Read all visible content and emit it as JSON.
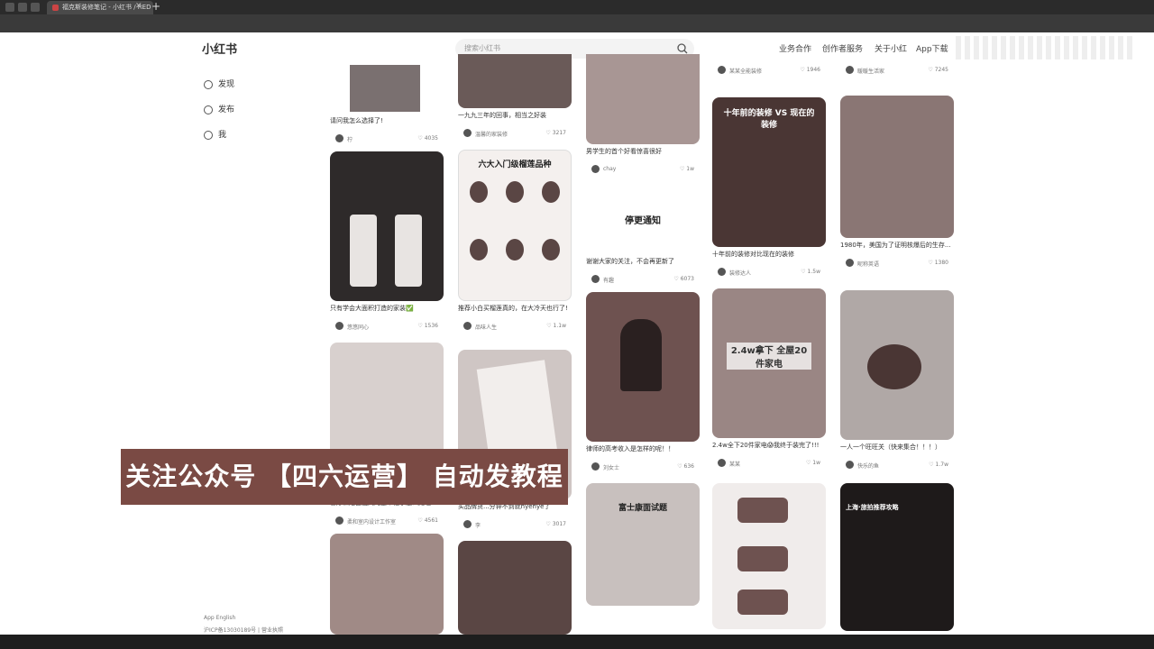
{
  "browser": {
    "tab_title": "福克斯装修笔记 - 小红书 / RED",
    "tab_close": "✕",
    "new_tab": "+"
  },
  "header": {
    "logo": "小红书",
    "search_placeholder": "搜索小红书",
    "nav": [
      "业务合作",
      "创作者服务",
      "关于小红",
      "App下载"
    ]
  },
  "sidebar": {
    "items": [
      {
        "label": "发现",
        "icon": "home-icon"
      },
      {
        "label": "发布",
        "icon": "plus-icon"
      },
      {
        "label": "我",
        "icon": "user-icon"
      }
    ],
    "footer_lang": "App   English",
    "footer_text": "沪ICP备13030189号 | 营业执照"
  },
  "feed": {
    "col1": [
      {
        "title": "请问我怎么选择了!",
        "author": "柠",
        "likes": "4035",
        "color": "#7a7070"
      },
      {
        "title": "只有学会大面积打造的家装✅",
        "author": "悠悠同心",
        "likes": "1536",
        "color": "#2e2a2a"
      },
      {
        "title": "客厅和阳台之间的这个柱子怎么处理",
        "author": "柔和室内设计工作室",
        "likes": "4561",
        "color": "#d8d0ce"
      },
      {
        "title": "",
        "author": "",
        "likes": "",
        "color": "#a08a86"
      }
    ],
    "col2": [
      {
        "title": "一九九三年的回事，相当之好装",
        "author": "温馨的家装修",
        "likes": "3217",
        "color": "#6a5a58"
      },
      {
        "title": "推荐小白买榴莲真的，在大冷天也行了!",
        "author": "品味人生",
        "likes": "1.1w",
        "color": "#f4f0ee",
        "overlay": "六大入门级榴莲品种"
      },
      {
        "title": "买品牌货...分钟不到就hyehye了",
        "author": "李",
        "likes": "3017",
        "color": "#cfc6c4"
      },
      {
        "title": "",
        "author": "",
        "likes": "",
        "color": "#5a4644"
      }
    ],
    "col3": [
      {
        "title": "男学生的首个好看惊喜很好",
        "author": "chay",
        "likes": "1w",
        "color": "#a89694"
      },
      {
        "title": "谢谢大家的关注，不会再更新了",
        "author": "有趣",
        "likes": "6073",
        "color": "#ffffff",
        "overlay": "停更通知"
      },
      {
        "title": "律师的高考收入是怎样的呢！！",
        "author": "刘女士",
        "likes": "636",
        "color": "#6e5250"
      },
      {
        "title": "",
        "author": "",
        "likes": "",
        "color": "#c8c0be",
        "overlay": "富士康面试题"
      }
    ],
    "col4": [
      {
        "title": "",
        "author": "某某全能装修",
        "likes": "1946",
        "color": "#ffffff"
      },
      {
        "title": "十年前的装修对比现在的装修",
        "author": "装修达人",
        "likes": "1.5w",
        "color": "#4a3634",
        "overlay": "十年前的装修 VS 现在的装修"
      },
      {
        "title": "2.4w全下20件家电😱我终于装完了!!!",
        "author": "某某",
        "likes": "1w",
        "color": "#9a8684",
        "overlay": "2.4w拿下 全屋20件家电"
      },
      {
        "title": "",
        "author": "",
        "likes": "",
        "color": "#f0eceb"
      }
    ],
    "col5": [
      {
        "title": "",
        "author": "暖暖生活家",
        "likes": "7245",
        "color": "#ffffff"
      },
      {
        "title": "1980年，美国为了证明核爆后的生存...",
        "author": "昵称英语",
        "likes": "1380",
        "color": "#8a7674"
      },
      {
        "title": "一人一个旺旺关（快来集合！！！）",
        "author": "快乐的鱼",
        "likes": "1.7w",
        "color": "#b0a8a6"
      },
      {
        "title": "上海·旅拍推荐攻略",
        "author": "",
        "likes": "",
        "color": "#1e1a1a"
      }
    ]
  },
  "banner": {
    "text": "关注公众号 【四六运营】 自动发教程"
  }
}
